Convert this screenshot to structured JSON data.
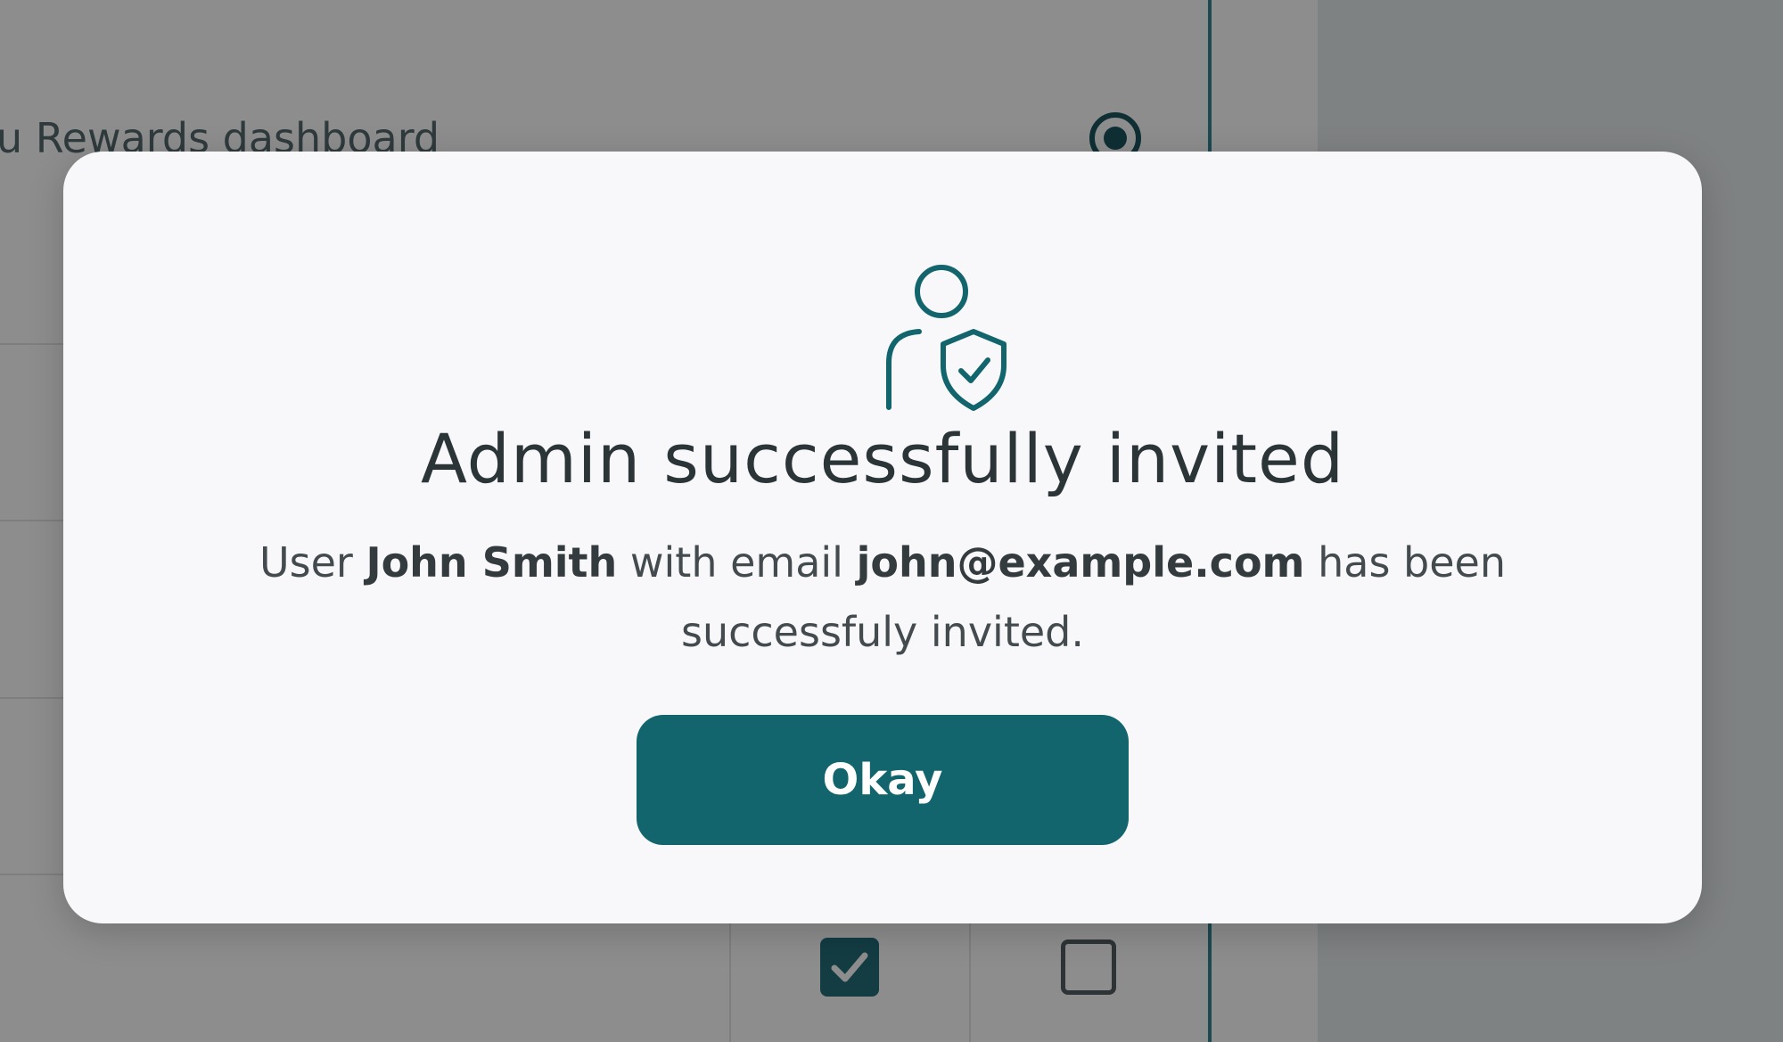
{
  "background": {
    "row_text": "u Rewards dashboard"
  },
  "modal": {
    "icon": "user-shield-icon",
    "title": "Admin successfully invited",
    "message": {
      "prefix": "User ",
      "user_name": "John Smith",
      "middle": " with email ",
      "email": "john@example.com",
      "suffix": " has been successfuly invited."
    },
    "okay_label": "Okay"
  },
  "colors": {
    "accent": "#12646d",
    "title_text": "#2b3538",
    "body_text": "#434b4e",
    "overlay": "#8b8b8b"
  }
}
